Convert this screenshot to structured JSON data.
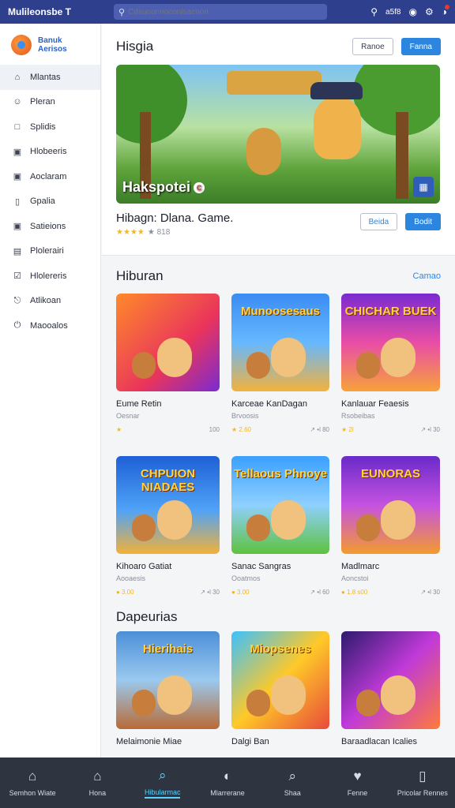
{
  "colors": {
    "topbar": "#2e3f8e",
    "accent": "#2c86e0",
    "bottomnav": "#2f3441",
    "active_nav": "#5bd2ff"
  },
  "topbar": {
    "title": "Mulileonsbe T",
    "search_value": "",
    "search_placeholder": "Cdsuoonnoconisacnon",
    "status_text": "a5f8"
  },
  "sidebar": {
    "brand_line1": "Banuk",
    "brand_line2": "Aerisos",
    "items": [
      {
        "label": "Mlantas",
        "icon": "home-icon"
      },
      {
        "label": "Pleran",
        "icon": "user-icon"
      },
      {
        "label": "Splidis",
        "icon": "square-icon"
      },
      {
        "label": "Hlobeeris",
        "icon": "box-icon"
      },
      {
        "label": "Aoclaram",
        "icon": "box-icon"
      },
      {
        "label": "Gpalia",
        "icon": "doc-icon"
      },
      {
        "label": "Satieions",
        "icon": "box-icon"
      },
      {
        "label": "Plolerairi",
        "icon": "image-icon"
      },
      {
        "label": "Hlolereris",
        "icon": "check-icon"
      },
      {
        "label": "Atlikoan",
        "icon": "bell-icon"
      },
      {
        "label": "Maooalos",
        "icon": "power-icon"
      }
    ]
  },
  "featured": {
    "heading": "Hisgia",
    "btn_secondary": "Ranoe",
    "btn_primary": "Fanna",
    "hero_title": "Hakspotei",
    "game_name": "Hibagn: Dlana. Game.",
    "rating_stars": "★★★★",
    "rating_text": "★ 818",
    "btn_a": "Beida",
    "btn_b": "Bodit"
  },
  "section1": {
    "title": "Hiburan",
    "link": "Camao",
    "tiles": [
      {
        "thumb_text": "",
        "name": "Eume Retin",
        "sub": "Oesnar",
        "stars": "★",
        "meta": "100",
        "bg": "linear-gradient(135deg,#ff8a2a,#e9345c 60%,#7a2bd1)"
      },
      {
        "thumb_text": "Munoosesaus",
        "name": "Karceae KanDagan",
        "sub": "Brvoosis",
        "stars": "★ 2.60",
        "meta": "↗ •l 80",
        "bg": "linear-gradient(180deg,#3a8df2,#66b8ff 50%,#f3b23c)"
      },
      {
        "thumb_text": "CHICHAR BUEK",
        "name": "Kanlauar Feaesis",
        "sub": "Rsobeibas",
        "stars": "★ 2l",
        "meta": "↗ •l 30",
        "bg": "linear-gradient(180deg,#7a2ad0,#e94da7 50%,#f7a23a)"
      },
      {
        "thumb_text": "CHPUION NIADAES",
        "name": "Kihoaro Gatiat",
        "sub": "Aooaesis",
        "stars": "● 3.00",
        "meta": "↗ •l 30",
        "bg": "linear-gradient(180deg,#1e5fd6,#4fa3f7 55%,#f2b13a)"
      },
      {
        "thumb_text": "Tellaous Phnoye",
        "name": "Sanac Sangras",
        "sub": "Ooatmos",
        "stars": "● 3.00",
        "meta": "↗ •l 60",
        "bg": "linear-gradient(180deg,#3aa0ff,#8fd0ff 50%,#5ec23e)"
      },
      {
        "thumb_text": "EUNORAS",
        "name": "Madlmarc",
        "sub": "Aoncstoi",
        "stars": "● 1.8 s00",
        "meta": "↗ •l 30",
        "bg": "linear-gradient(180deg,#6a2ac9,#c552e0 50%,#f39b2f)"
      }
    ]
  },
  "section2": {
    "title": "Dapeurias",
    "tiles": [
      {
        "thumb_text": "Hierihais",
        "name": "Melaimonie Miae",
        "bg": "linear-gradient(180deg,#4c8fd8,#9ac9ef 50%,#b86b35)"
      },
      {
        "thumb_text": "Miopsenes",
        "name": "Dalgi Ban",
        "bg": "linear-gradient(135deg,#3ac1ff,#ffc928 50%,#e84a3a)"
      },
      {
        "thumb_text": "",
        "name": "Baraadlacan Icalies",
        "bg": "linear-gradient(135deg,#2d1a6e,#c03ad8 50%,#ff7a3a)"
      }
    ]
  },
  "bottomnav": [
    {
      "label": "Semhon Wiate",
      "icon": "home-icon"
    },
    {
      "label": "Hona",
      "icon": "house-icon"
    },
    {
      "label": "Hibularmac",
      "icon": "search-icon"
    },
    {
      "label": "Mlarrerane",
      "icon": "globe-icon"
    },
    {
      "label": "Shaa",
      "icon": "search-icon"
    },
    {
      "label": "Fenne",
      "icon": "heart-icon"
    },
    {
      "label": "Pricolar Rennes",
      "icon": "doc-icon"
    }
  ]
}
